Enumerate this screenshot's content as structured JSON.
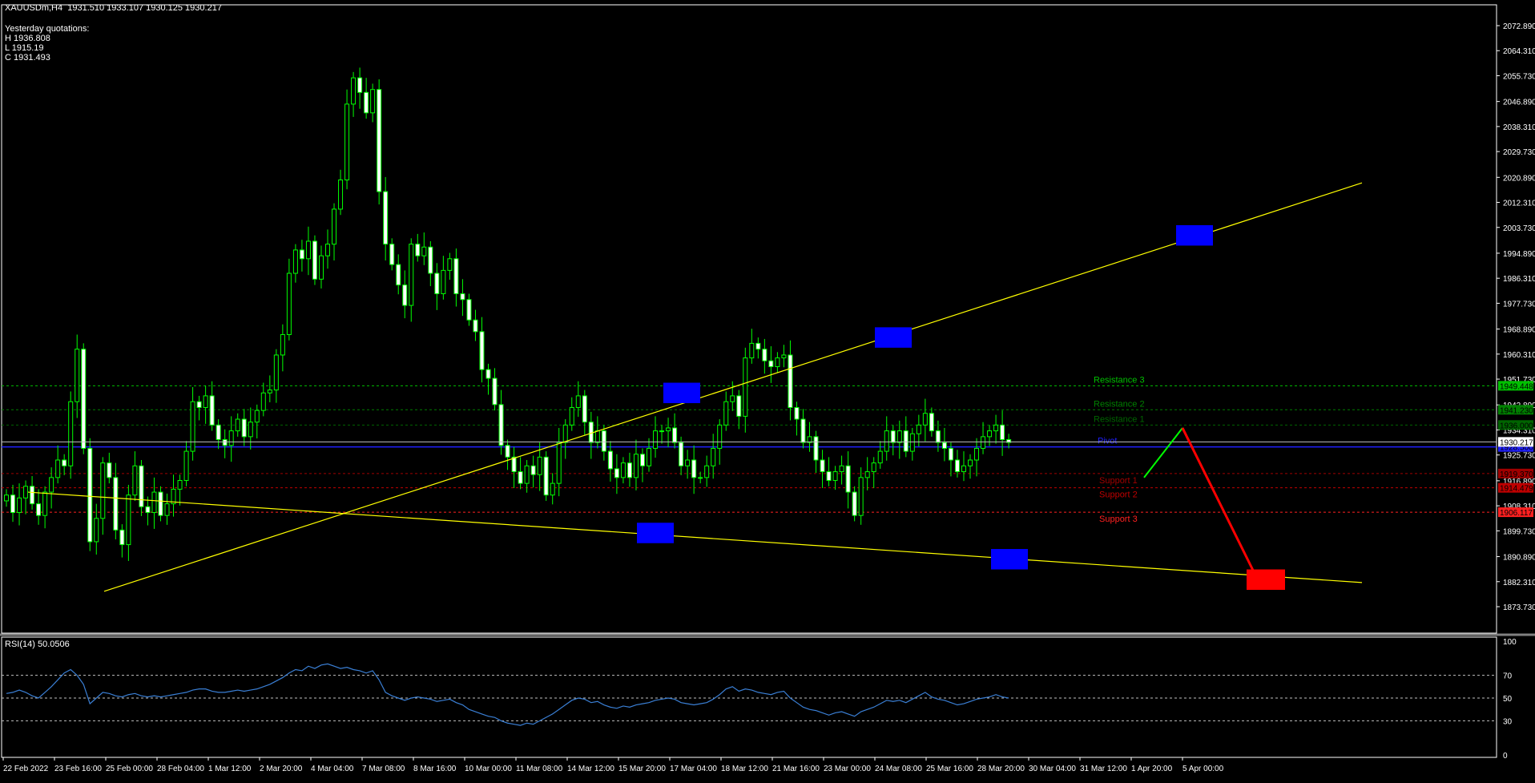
{
  "header": {
    "symbol": "XAUUSDm,H4",
    "ohlc": "1931.510 1933.107 1930.125 1930.217"
  },
  "yesterday": {
    "title": "Yesterday quotations:",
    "high": "H 1936.808",
    "low": "L 1915.19",
    "close": "C 1931.493"
  },
  "rsi": {
    "label": "RSI(14) 50.0506"
  },
  "chart_data": {
    "type": "candlestick",
    "price_axis": [
      "2072.890",
      "2064.310",
      "2055.730",
      "2046.890",
      "2038.310",
      "2029.730",
      "2020.890",
      "2012.310",
      "2003.730",
      "1994.890",
      "1986.310",
      "1977.730",
      "1968.890",
      "1960.310",
      "1951.730",
      "1942.890",
      "1934.310",
      "1925.730",
      "1916.890",
      "1908.310",
      "1899.730",
      "1890.890",
      "1882.310",
      "1873.730"
    ],
    "ylim": [
      1873.73,
      2072.89
    ],
    "time_axis": [
      "22 Feb 2022",
      "23 Feb 16:00",
      "25 Feb 00:00",
      "28 Feb 04:00",
      "1 Mar 12:00",
      "2 Mar 20:00",
      "4 Mar 04:00",
      "7 Mar 08:00",
      "8 Mar 16:00",
      "10 Mar 00:00",
      "11 Mar 08:00",
      "14 Mar 12:00",
      "15 Mar 20:00",
      "17 Mar 04:00",
      "18 Mar 12:00",
      "21 Mar 16:00",
      "23 Mar 00:00",
      "24 Mar 08:00",
      "25 Mar 16:00",
      "28 Mar 20:00",
      "30 Mar 04:00",
      "31 Mar 12:00",
      "1 Apr 20:00",
      "5 Apr 00:00"
    ],
    "levels": [
      {
        "name": "Resistance 3",
        "price": "1949.448",
        "value": 1949.448,
        "color": "#00c000"
      },
      {
        "name": "Resistance 2",
        "price": "1941.230",
        "value": 1941.23,
        "color": "#008000"
      },
      {
        "name": "Resistance 1",
        "price": "1936.000",
        "value": 1936.0,
        "color": "#006400"
      },
      {
        "name": "Pivot",
        "price": "1928.500",
        "value": 1928.5,
        "color": "#2020ff"
      },
      {
        "name": "Support 1",
        "price": "1919.370",
        "value": 1919.37,
        "color": "#a00000"
      },
      {
        "name": "Support 2",
        "price": "1914.479",
        "value": 1914.479,
        "color": "#c00000"
      },
      {
        "name": "Support 3",
        "price": "1906.117",
        "value": 1906.117,
        "color": "#ff2020"
      }
    ],
    "current_price": "1930.217",
    "current_value": 1930.217,
    "closes": [
      1912,
      1906,
      1911,
      1915,
      1909,
      1905,
      1913,
      1918,
      1924,
      1922,
      1944,
      1962,
      1928,
      1896,
      1904,
      1923,
      1918,
      1900,
      1895,
      1912,
      1922,
      1908,
      1906,
      1913,
      1905,
      1909,
      1914,
      1917,
      1927,
      1944,
      1942,
      1946,
      1936,
      1931,
      1929,
      1934,
      1938,
      1932,
      1937,
      1941,
      1947,
      1948,
      1960,
      1967,
      1988,
      1996,
      1993,
      1999,
      1986,
      1994,
      1998,
      2010,
      2020,
      2046,
      2055,
      2050,
      2043,
      2051,
      2016,
      1998,
      1991,
      1984,
      1977,
      1998,
      1994,
      1997,
      1988,
      1981,
      1989,
      1993,
      1981,
      1979,
      1972,
      1968,
      1955,
      1952,
      1943,
      1929,
      1925,
      1920,
      1916,
      1922,
      1919,
      1925,
      1912,
      1916,
      1930,
      1936,
      1942,
      1946,
      1937,
      1930,
      1934,
      1927,
      1921,
      1918,
      1923,
      1918,
      1926,
      1922,
      1928,
      1934,
      1934,
      1935,
      1930,
      1922,
      1924,
      1918,
      1918,
      1922,
      1928,
      1936,
      1944,
      1946,
      1939,
      1959,
      1964,
      1962,
      1958,
      1956,
      1959,
      1960,
      1942,
      1938,
      1930,
      1932,
      1924,
      1920,
      1917,
      1920,
      1922,
      1913,
      1905,
      1918,
      1920,
      1923,
      1927,
      1934,
      1930,
      1934,
      1927,
      1933,
      1936,
      1940,
      1934,
      1930,
      1928,
      1924,
      1920,
      1922,
      1924,
      1928,
      1932,
      1934,
      1936,
      1931,
      1930
    ],
    "series": [
      {
        "name": "RSI(14)",
        "values": [
          54,
          55,
          57,
          55,
          52,
          50,
          55,
          60,
          66,
          72,
          75,
          70,
          62,
          45,
          50,
          55,
          54,
          52,
          51,
          53,
          54,
          52,
          51,
          52,
          51,
          52,
          53,
          54,
          55,
          57,
          58,
          58,
          56,
          55,
          55,
          56,
          57,
          56,
          57,
          58,
          60,
          62,
          65,
          68,
          72,
          75,
          74,
          78,
          76,
          79,
          80,
          78,
          76,
          77,
          75,
          74,
          72,
          74,
          66,
          55,
          52,
          50,
          48,
          50,
          51,
          50,
          49,
          47,
          48,
          49,
          46,
          44,
          40,
          38,
          36,
          34,
          33,
          30,
          28,
          27,
          26,
          28,
          27,
          30,
          33,
          36,
          40,
          44,
          48,
          50,
          49,
          46,
          47,
          44,
          42,
          41,
          43,
          42,
          44,
          45,
          46,
          48,
          49,
          50,
          49,
          46,
          45,
          44,
          45,
          46,
          49,
          53,
          58,
          60,
          56,
          58,
          57,
          55,
          54,
          53,
          55,
          56,
          50,
          46,
          42,
          40,
          39,
          37,
          35,
          37,
          38,
          36,
          34,
          38,
          40,
          42,
          45,
          48,
          47,
          48,
          46,
          49,
          52,
          55,
          51,
          49,
          48,
          46,
          44,
          45,
          47,
          49,
          50,
          51,
          53,
          51,
          50
        ]
      }
    ],
    "rsi_levels": [
      70,
      50,
      30
    ],
    "rsi_axis": [
      "100",
      "70",
      "50",
      "30",
      "0"
    ]
  },
  "colors": {
    "background": "#000000",
    "bull": "#00ff00",
    "bear": "#ffffff",
    "trendline": "#ffff00",
    "rsi_line": "#3a7fd5",
    "box_blue": "#0000ff",
    "box_red": "#ff0000"
  }
}
